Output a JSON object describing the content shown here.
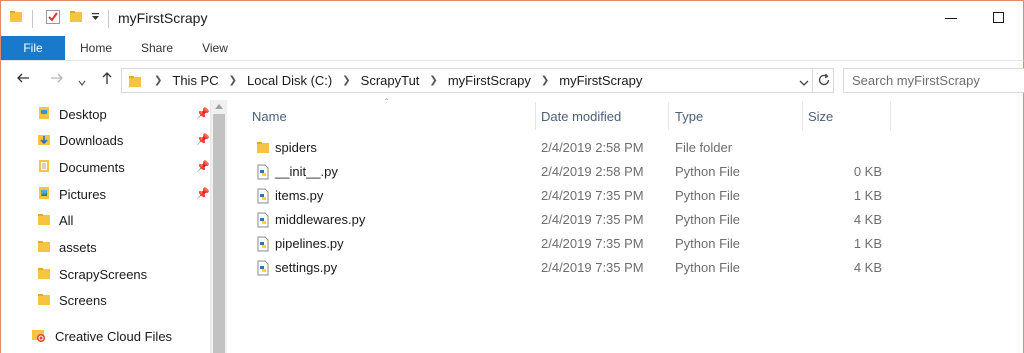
{
  "window": {
    "title": "myFirstScrapy",
    "minimize_icon": "minimize-icon",
    "maximize_icon": "maximize-icon"
  },
  "quick_access_toolbar": {
    "icons": [
      "folder-icon",
      "properties-check-icon",
      "new-folder-icon",
      "customize-dropdown-icon"
    ]
  },
  "ribbon": {
    "tabs": [
      "File",
      "Home",
      "Share",
      "View"
    ],
    "active_color": "#1979ca"
  },
  "navigation": {
    "back_icon": "back-arrow-icon",
    "forward_icon": "forward-arrow-icon",
    "up_icon": "up-arrow-icon",
    "breadcrumb": [
      "This PC",
      "Local Disk (C:)",
      "ScrapyTut",
      "myFirstScrapy",
      "myFirstScrapy"
    ],
    "dropdown_icon": "chevron-down-icon",
    "refresh_icon": "refresh-icon"
  },
  "search": {
    "placeholder": "Search myFirstScrapy",
    "value": ""
  },
  "sidebar": {
    "items": [
      {
        "label": "Desktop",
        "icon": "desktop-folder-icon",
        "pinned": true
      },
      {
        "label": "Downloads",
        "icon": "downloads-folder-icon",
        "pinned": true
      },
      {
        "label": "Documents",
        "icon": "documents-folder-icon",
        "pinned": true
      },
      {
        "label": "Pictures",
        "icon": "pictures-folder-icon",
        "pinned": true
      },
      {
        "label": "All",
        "icon": "folder-icon",
        "pinned": false
      },
      {
        "label": "assets",
        "icon": "folder-icon",
        "pinned": false
      },
      {
        "label": "ScrapyScreens",
        "icon": "folder-icon",
        "pinned": false
      },
      {
        "label": "Screens",
        "icon": "folder-icon",
        "pinned": false
      },
      {
        "label": "Creative Cloud Files",
        "icon": "creative-cloud-icon",
        "pinned": false
      }
    ]
  },
  "file_list": {
    "columns": [
      "Name",
      "Date modified",
      "Type",
      "Size"
    ],
    "sorted_by": "Name",
    "rows": [
      {
        "name": "spiders",
        "date": "2/4/2019 2:58 PM",
        "type": "File folder",
        "size": "",
        "icon": "folder-icon"
      },
      {
        "name": "__init__.py",
        "date": "2/4/2019 2:58 PM",
        "type": "Python File",
        "size": "0 KB",
        "icon": "python-file-icon"
      },
      {
        "name": "items.py",
        "date": "2/4/2019 7:35 PM",
        "type": "Python File",
        "size": "1 KB",
        "icon": "python-file-icon"
      },
      {
        "name": "middlewares.py",
        "date": "2/4/2019 7:35 PM",
        "type": "Python File",
        "size": "4 KB",
        "icon": "python-file-icon"
      },
      {
        "name": "pipelines.py",
        "date": "2/4/2019 7:35 PM",
        "type": "Python File",
        "size": "1 KB",
        "icon": "python-file-icon"
      },
      {
        "name": "settings.py",
        "date": "2/4/2019 7:35 PM",
        "type": "Python File",
        "size": "4 KB",
        "icon": "python-file-icon"
      }
    ]
  }
}
